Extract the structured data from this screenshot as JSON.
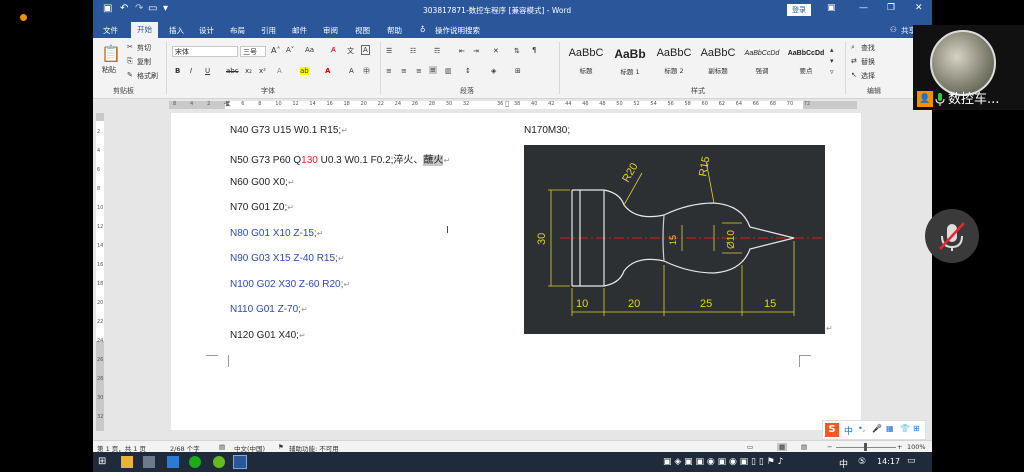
{
  "window": {
    "title": "303817871-数控车程序 [兼容模式] - Word",
    "login": "登录"
  },
  "tabs": [
    "文件",
    "开始",
    "插入",
    "设计",
    "布局",
    "引用",
    "邮件",
    "审阅",
    "视图",
    "帮助"
  ],
  "tell_me": "操作说明搜索",
  "share": "共享",
  "clipboard": {
    "paste": "粘贴",
    "cut": "剪切",
    "copy": "复制",
    "format_painter": "格式刷",
    "label": "剪贴板"
  },
  "font": {
    "name": "宋体",
    "size": "三号",
    "label": "字体"
  },
  "paragraph_label": "段落",
  "styles": {
    "label": "样式",
    "items": [
      {
        "preview": "AaBbC",
        "name": "标题"
      },
      {
        "preview": "AaBb",
        "name": "标题 1"
      },
      {
        "preview": "AaBbC",
        "name": "标题 2"
      },
      {
        "preview": "AaBbC",
        "name": "副标题"
      },
      {
        "preview": "AaBbCcDd",
        "name": "强调"
      },
      {
        "preview": "AaBbCcDd",
        "name": "要点"
      }
    ]
  },
  "editing": {
    "find": "查找",
    "replace": "替换",
    "select": "选择",
    "label": "编辑"
  },
  "ruler_numbers": [
    "8",
    "4",
    "2",
    "4",
    "6",
    "8",
    "10",
    "12",
    "14",
    "16",
    "18",
    "20",
    "22",
    "24",
    "26",
    "28",
    "30",
    "32",
    "36",
    "38",
    "40",
    "42",
    "44",
    "46",
    "48",
    "50",
    "52",
    "54",
    "56",
    "58",
    "60",
    "62",
    "64",
    "66",
    "68",
    "70",
    "72"
  ],
  "vruler_numbers": [
    "2",
    "4",
    "6",
    "8",
    "10",
    "12",
    "14",
    "16",
    "18",
    "20",
    "22",
    "24",
    "26",
    "28",
    "30",
    "32"
  ],
  "document": {
    "lines": [
      {
        "text": "N40 G73 U15 W0.1 R15;",
        "color": "black"
      },
      {
        "pre": "N50 G73 P60 Q",
        "red": "130",
        "post": " U0.3 W0.1 F0.2;淬火、",
        "hl": "蘸火"
      },
      {
        "text": "N60 G00 X0;",
        "color": "black"
      },
      {
        "text": "N70 G01 Z0;",
        "color": "black"
      },
      {
        "text": "N80 G01 X10 Z-15;",
        "color": "blue"
      },
      {
        "text": "N90 G03 X15 Z-40 R15;",
        "color": "blue"
      },
      {
        "text": "N100 G02 X30 Z-60 R20;",
        "color": "blue"
      },
      {
        "text": "N110 G01 Z-70;",
        "color": "blue"
      },
      {
        "text": "N120 G01 X40;",
        "color": "black"
      }
    ],
    "right_line": "N170M30;",
    "para_mark": "↵"
  },
  "drawing": {
    "labels": {
      "r20": "R20",
      "r15": "R15",
      "d30": "30",
      "d15": "15",
      "d10": "Ø10",
      "l10": "10",
      "l20": "20",
      "l25": "25",
      "l15": "15"
    },
    "background": "#2c3033",
    "outline_color": "#e8e8e8",
    "dim_color": "#e0d22a",
    "center_color": "#d81e1e"
  },
  "status": {
    "page": "第 1 页，共 1 页",
    "words": "2/68 个字",
    "lang": "中文(中国)",
    "accessibility": "辅助功能: 不可用",
    "zoom": "100%"
  },
  "ime": {
    "lang": "中"
  },
  "taskbar": {
    "ime": "中",
    "time": "14:17",
    "sogou_letter": "S"
  },
  "call": {
    "name": "数控车..."
  }
}
